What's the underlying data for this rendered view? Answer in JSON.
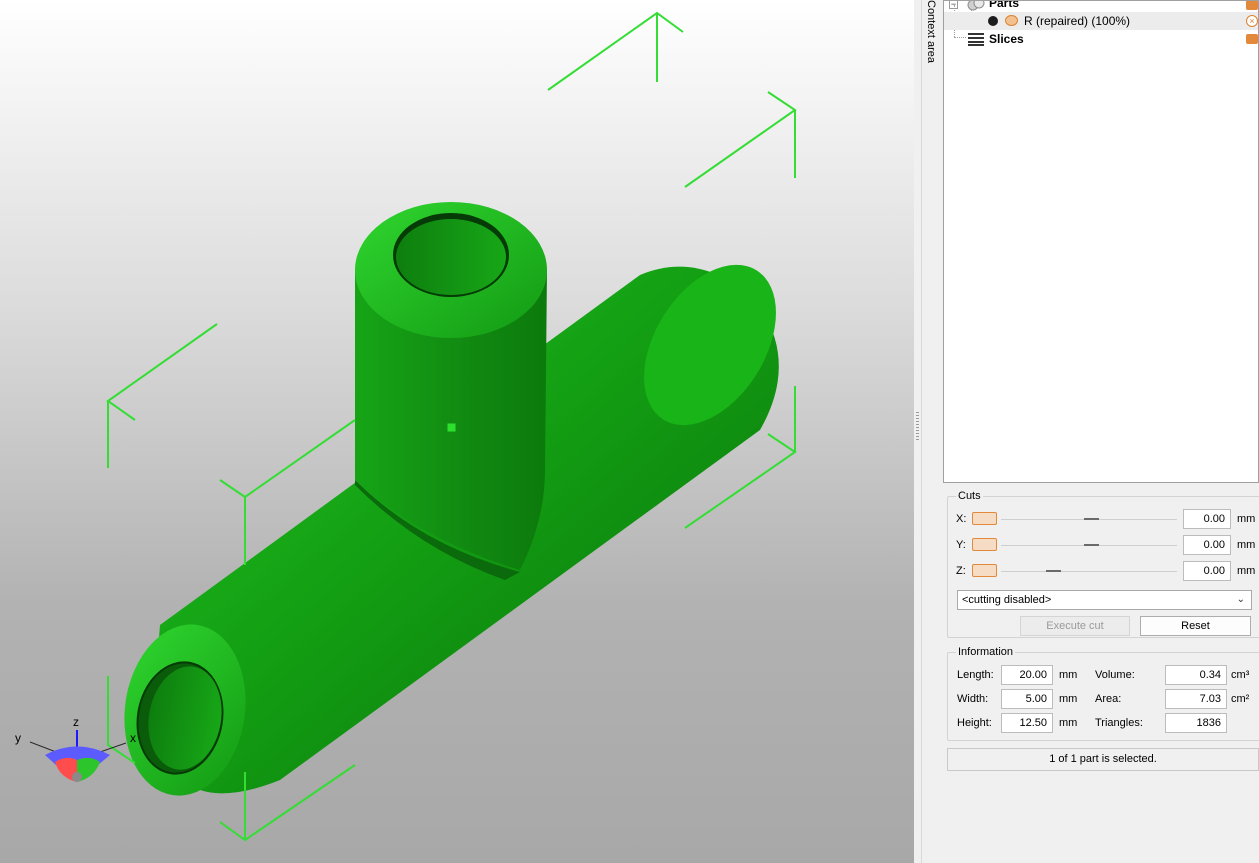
{
  "sidebar": {
    "context_label": "Context area"
  },
  "tree": {
    "parts_label": "Parts",
    "part_item_label": "R (repaired) (100%)",
    "slices_label": "Slices",
    "expander_symbol": "−",
    "accent_color": "#e2893b"
  },
  "cuts": {
    "title": "Cuts",
    "x_label": "X:",
    "y_label": "Y:",
    "z_label": "Z:",
    "x_value": "0.00",
    "y_value": "0.00",
    "z_value": "0.00",
    "unit": "mm",
    "mode_selected": "<cutting disabled>",
    "execute_label": "Execute cut",
    "reset_label": "Reset"
  },
  "information": {
    "title": "Information",
    "length_label": "Length:",
    "length_value": "20.00",
    "width_label": "Width:",
    "width_value": "5.00",
    "height_label": "Height:",
    "height_value": "12.50",
    "mm_unit": "mm",
    "volume_label": "Volume:",
    "volume_value": "0.34",
    "volume_unit": "cm³",
    "area_label": "Area:",
    "area_value": "7.03",
    "area_unit": "cm²",
    "triangles_label": "Triangles:",
    "triangles_value": "1836"
  },
  "status": {
    "text": "1 of 1 part is selected."
  },
  "axes": {
    "x": "x",
    "y": "y",
    "z": "z"
  },
  "colors": {
    "model": "#1fae1f",
    "bbox": "#33dd33"
  }
}
